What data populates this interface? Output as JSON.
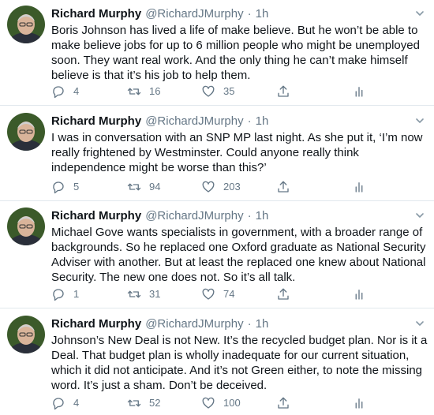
{
  "tweets": [
    {
      "name": "Richard Murphy",
      "handle": "@RichardJMurphy",
      "dot": "·",
      "time": "1h",
      "text": "Boris Johnson has lived a life of make believe. But he won’t be able to\nmake believe jobs for up to 6 million people who might be unemployed\nsoon. They want real work. And the only thing he can’t make himself\nbelieve is that it’s his job to help them.",
      "replies": "4",
      "retweets": "16",
      "likes": "35"
    },
    {
      "name": "Richard Murphy",
      "handle": "@RichardJMurphy",
      "dot": "·",
      "time": "1h",
      "text": "I was in conversation with an SNP MP last night. As she put it, ‘I’m now\nreally frightened by Westminster. Could anyone really think\nindependence might be worse than this?’",
      "replies": "5",
      "retweets": "94",
      "likes": "203"
    },
    {
      "name": "Richard Murphy",
      "handle": "@RichardJMurphy",
      "dot": "·",
      "time": "1h",
      "text": "Michael Gove wants specialists in government, with a broader range of\nbackgrounds. So he replaced one Oxford graduate as National Security\nAdviser with another. But at least the replaced one knew about National\nSecurity. The new one does not. So it’s all talk.",
      "replies": "1",
      "retweets": "31",
      "likes": "74"
    },
    {
      "name": "Richard Murphy",
      "handle": "@RichardJMurphy",
      "dot": "·",
      "time": "1h",
      "text": "Johnson’s New Deal is not New. It’s the recycled budget plan. Nor is it a\nDeal. That budget plan is wholly inadequate for our current situation,\nwhich it did not anticipate. And it’s not Green either, to note the missing\nword. It’s just a sham. Don’t be deceived.",
      "replies": "4",
      "retweets": "52",
      "likes": "100"
    }
  ]
}
